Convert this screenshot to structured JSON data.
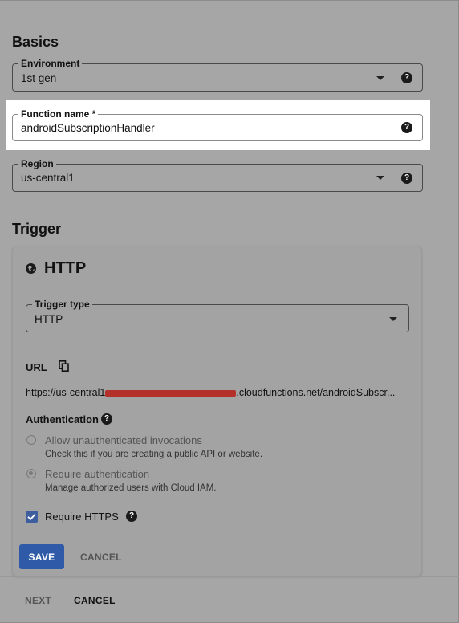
{
  "basics": {
    "title": "Basics",
    "environment": {
      "label": "Environment",
      "value": "1st gen"
    },
    "function_name": {
      "label": "Function name *",
      "value": "androidSubscriptionHandler"
    },
    "region": {
      "label": "Region",
      "value": "us-central1"
    }
  },
  "trigger": {
    "title": "Trigger",
    "card_title": "HTTP",
    "trigger_type": {
      "label": "Trigger type",
      "value": "HTTP"
    },
    "url": {
      "label": "URL",
      "prefix": "https://us-central1",
      "suffix": ".cloudfunctions.net/androidSubscr..."
    },
    "authentication": {
      "label": "Authentication",
      "options": [
        {
          "label": "Allow unauthenticated invocations",
          "description": "Check this if you are creating a public API or website.",
          "selected": false
        },
        {
          "label": "Require authentication",
          "description": "Manage authorized users with Cloud IAM.",
          "selected": true
        }
      ]
    },
    "require_https": {
      "label": "Require HTTPS",
      "checked": true
    },
    "save_label": "SAVE",
    "cancel_label": "CANCEL"
  },
  "footer": {
    "next_label": "NEXT",
    "cancel_label": "CANCEL"
  },
  "icons": {
    "help": "help-circle-icon",
    "dropdown": "arrow-drop-down-icon",
    "globe": "globe-icon",
    "copy": "copy-icon",
    "check": "check-icon"
  },
  "colors": {
    "primary_button": "#2e5aa8",
    "checkbox": "#3d5fa0",
    "redaction": "#b4302a"
  }
}
